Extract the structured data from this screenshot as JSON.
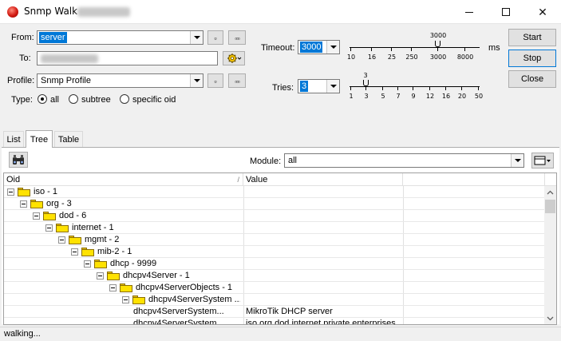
{
  "window": {
    "title": "Snmp Walk",
    "controls": {
      "minimize": "—",
      "maximize": "☐",
      "close": "✕"
    }
  },
  "form": {
    "from": {
      "label": "From:",
      "value": "server"
    },
    "to": {
      "label": "To:",
      "value": ""
    },
    "profile": {
      "label": "Profile:",
      "value": "Snmp Profile"
    },
    "type": {
      "label": "Type:",
      "options": [
        "all",
        "subtree",
        "specific oid"
      ],
      "selected": "all"
    },
    "small_button": "▫",
    "dots_button": "▫▫▫"
  },
  "timeout": {
    "label": "Timeout:",
    "value": "3000",
    "unit": "ms",
    "current_label": "3000",
    "ticks": [
      "10",
      "16",
      "25",
      "250",
      "3000",
      "8000"
    ]
  },
  "tries": {
    "label": "Tries:",
    "value": "3",
    "current_label": "3",
    "ticks": [
      "1",
      "3",
      "5",
      "7",
      "9",
      "12",
      "16",
      "20",
      "50"
    ]
  },
  "buttons": {
    "start": "Start",
    "stop": "Stop",
    "close": "Close"
  },
  "tabs": [
    "List",
    "Tree",
    "Table"
  ],
  "active_tab": "Tree",
  "module": {
    "label": "Module:",
    "value": "all"
  },
  "grid": {
    "columns": [
      "Oid",
      "Value",
      ""
    ],
    "sort_indicator": "/",
    "rows": [
      {
        "level": 0,
        "text": "iso - 1",
        "value": "",
        "folder": true
      },
      {
        "level": 1,
        "text": "org - 3",
        "value": "",
        "folder": true
      },
      {
        "level": 2,
        "text": "dod - 6",
        "value": "",
        "folder": true
      },
      {
        "level": 3,
        "text": "internet - 1",
        "value": "",
        "folder": true
      },
      {
        "level": 4,
        "text": "mgmt - 2",
        "value": "",
        "folder": true
      },
      {
        "level": 5,
        "text": "mib-2 - 1",
        "value": "",
        "folder": true
      },
      {
        "level": 6,
        "text": "dhcp - 9999",
        "value": "",
        "folder": true
      },
      {
        "level": 7,
        "text": "dhcpv4Server - 1",
        "value": "",
        "folder": true
      },
      {
        "level": 8,
        "text": "dhcpv4ServerObjects - 1",
        "value": "",
        "folder": true
      },
      {
        "level": 9,
        "text": "dhcpv4ServerSystem ...",
        "value": "",
        "folder": true
      },
      {
        "level": 10,
        "text": "dhcpv4ServerSystem...",
        "value": "MikroTik DHCP server",
        "folder": false
      },
      {
        "level": 10,
        "text": "dhcpv4ServerSystem...",
        "value": "iso.org.dod.internet.private.enterprises",
        "folder": false
      }
    ]
  },
  "status": {
    "text": "walking..."
  }
}
